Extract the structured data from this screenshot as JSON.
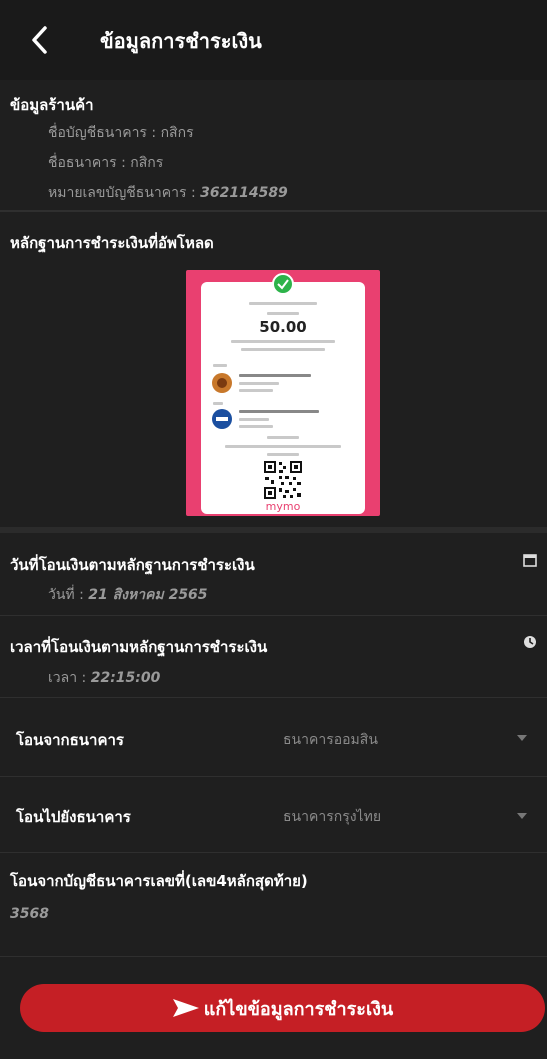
{
  "header": {
    "title": "ข้อมูลการชำระเงิน"
  },
  "shop": {
    "heading": "ข้อมูลร้านค้า",
    "account_name": "ชื่อบัญชีธนาคาร : กสิกร",
    "bank_name": "ชื่อธนาคาร : กสิกร",
    "account_no_label": "หมายเลขบัญชีธนาคาร : ",
    "account_no": "362114589"
  },
  "proof": {
    "heading": "หลักฐานการชำระเงินที่อัพโหลด",
    "amount": "50.00",
    "footer_logo": "mymo"
  },
  "date": {
    "label": "วันที่โอนเงินตามหลักฐานการชำระเงิน",
    "value_label": "วันที่ : ",
    "value": "21 สิงหาคม 2565"
  },
  "time": {
    "label": "เวลาที่โอนเงินตามหลักฐานการชำระเงิน",
    "value_label": "เวลา : ",
    "value": "22:15:00"
  },
  "from_bank": {
    "label": "โอนจากธนาคาร",
    "value": "ธนาคารออมสิน"
  },
  "to_bank": {
    "label": "โอนไปยังธนาคาร",
    "value": "ธนาคารกรุงไทย"
  },
  "account_last4": {
    "label": "โอนจากบัญชีธนาคารเลขที่(เลข4หลักสุดท้าย)",
    "value": "3568"
  },
  "edit_button": {
    "label": "แก้ไขข้อมูลการชำระเงิน"
  }
}
